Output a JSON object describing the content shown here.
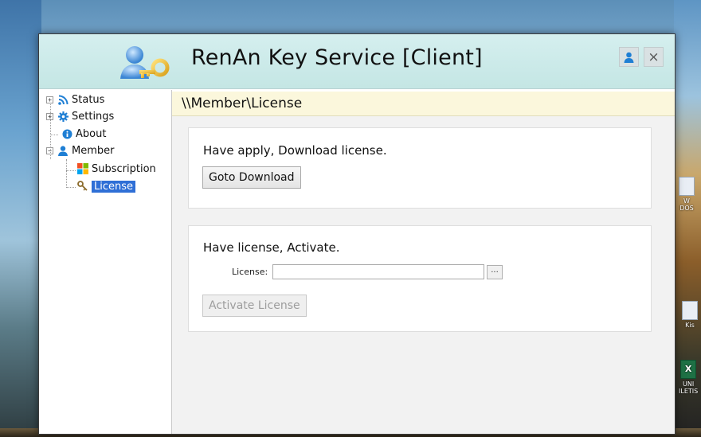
{
  "window": {
    "title": "RenAn Key Service  [Client]",
    "close_glyph": "×"
  },
  "tree": {
    "items": [
      {
        "label": "Status",
        "icon": "rss-icon",
        "expander": "+"
      },
      {
        "label": "Settings",
        "icon": "gear-icon",
        "expander": "+"
      },
      {
        "label": "About",
        "icon": "info-icon",
        "expander": ""
      },
      {
        "label": "Member",
        "icon": "user-icon",
        "expander": "−"
      },
      {
        "label": "Subscription",
        "icon": "windows-logo-icon",
        "expander": ""
      },
      {
        "label": "License",
        "icon": "key-icon",
        "expander": "",
        "selected": true
      }
    ]
  },
  "breadcrumb": "\\\\Member\\License",
  "download_panel": {
    "heading": "Have apply, Download license.",
    "button_label": "Goto Download"
  },
  "activate_panel": {
    "heading": "Have license, Activate.",
    "license_label": "License:",
    "license_value": "",
    "browse_label": "...",
    "button_label": "Activate License"
  },
  "desktop": {
    "icon_labels": [
      "W",
      "DOS",
      "Kis",
      "X",
      "UNI",
      "ILETIS"
    ]
  },
  "colors": {
    "titlebar": "#c4e6e4",
    "breadcrumb_bg": "#fbf7dc",
    "selection": "#2f6fd6"
  }
}
